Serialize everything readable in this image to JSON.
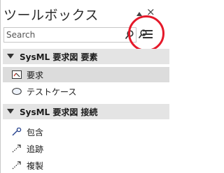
{
  "toolbox": {
    "title": "ツールボックス",
    "close_glyph": "×",
    "search": {
      "placeholder": "Search",
      "value": ""
    },
    "sections": [
      {
        "label": "SysML 要求図 要素",
        "items": [
          {
            "label": "要求",
            "icon": "requirement-icon"
          },
          {
            "label": "テストケース",
            "icon": "testcase-icon"
          }
        ]
      },
      {
        "label": "SysML 要求図 接続",
        "items": [
          {
            "label": "包含",
            "icon": "containment-icon"
          },
          {
            "label": "追跡",
            "icon": "trace-icon"
          },
          {
            "label": "複製",
            "icon": "copy-icon"
          }
        ]
      }
    ]
  },
  "colors": {
    "highlight_circle": "#e5192a",
    "section_header_bg": "#e4e4e4",
    "selected_item_bg": "#dcdcdc"
  }
}
